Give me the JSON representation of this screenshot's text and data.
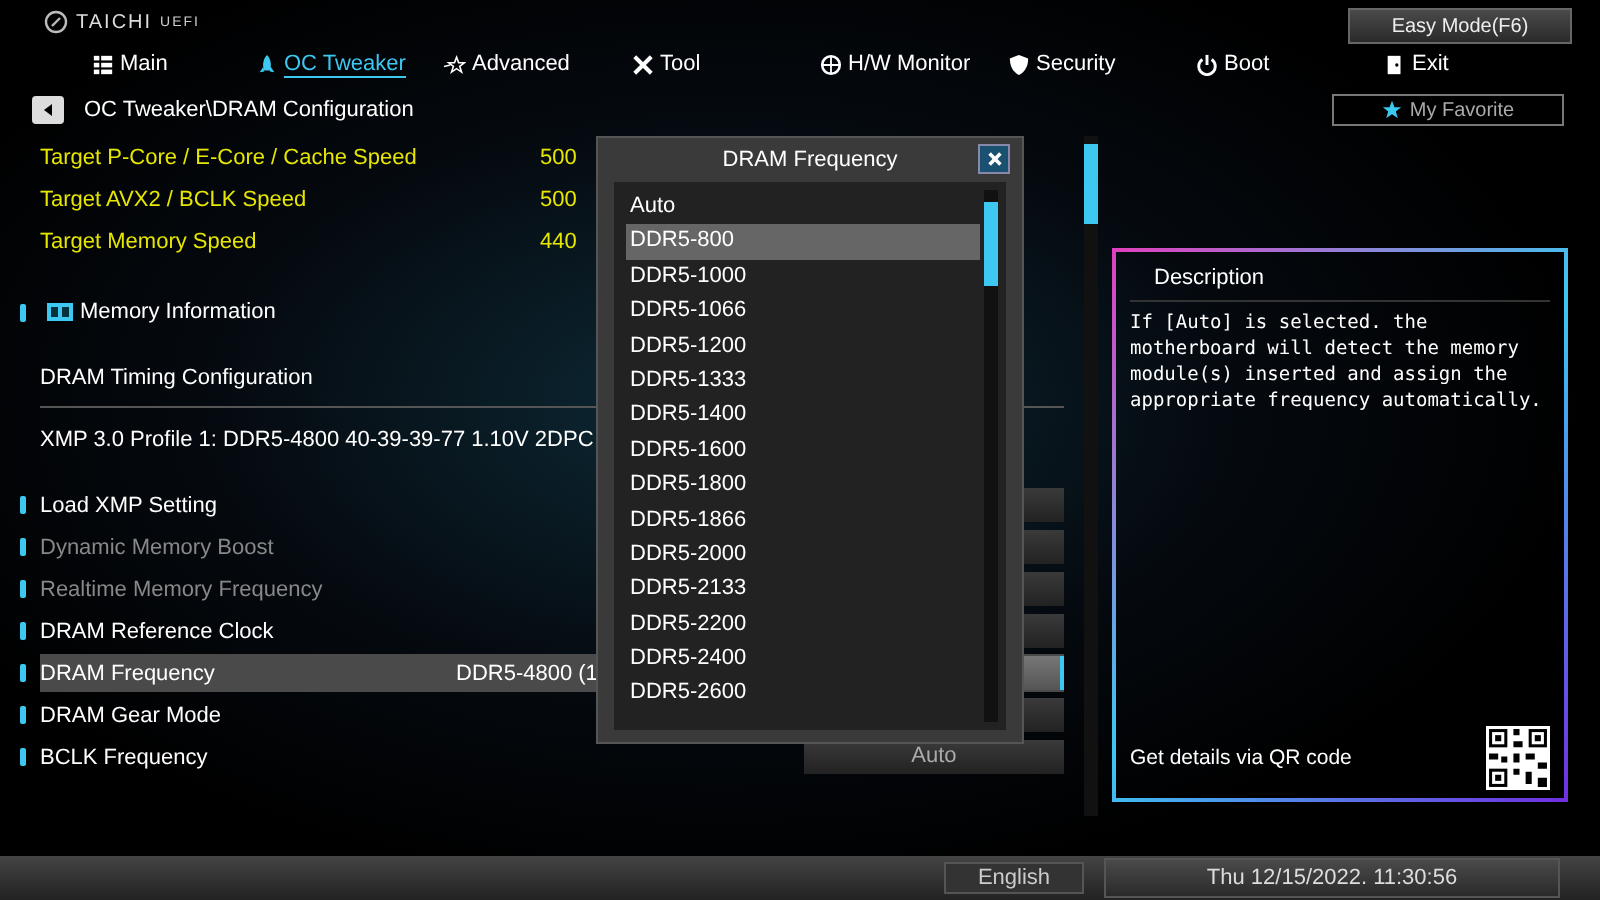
{
  "header": {
    "logo": "TAICHI",
    "logo_sub": "UEFI",
    "easy_mode": "Easy Mode(F6)",
    "my_favorite": "My Favorite"
  },
  "tabs": [
    {
      "label": "Main",
      "kind": "main",
      "selected": false
    },
    {
      "label": "OC Tweaker",
      "kind": "oc",
      "selected": true
    },
    {
      "label": "Advanced",
      "kind": "advanced",
      "selected": false
    },
    {
      "label": "Tool",
      "kind": "tool",
      "selected": false
    },
    {
      "label": "H/W Monitor",
      "kind": "monitor",
      "selected": false
    },
    {
      "label": "Security",
      "kind": "security",
      "selected": false
    },
    {
      "label": "Boot",
      "kind": "boot",
      "selected": false
    },
    {
      "label": "Exit",
      "kind": "exit",
      "selected": false
    }
  ],
  "breadcrumb": "OC Tweaker\\DRAM Configuration",
  "targets": [
    {
      "label": "Target P-Core / E-Core / Cache Speed",
      "value": "500"
    },
    {
      "label": "Target AVX2 / BCLK Speed",
      "value": "500"
    },
    {
      "label": "Target Memory Speed",
      "value": "440"
    }
  ],
  "memory_info": "Memory Information",
  "timing_config": "DRAM Timing Configuration",
  "xmp": "XMP 3.0 Profile 1: DDR5-4800 40-39-39-77 1.10V 2DPC",
  "settings": [
    {
      "label": "Load XMP Setting",
      "disabled": false,
      "selected": false
    },
    {
      "label": "Dynamic Memory Boost",
      "disabled": true,
      "selected": false
    },
    {
      "label": "Realtime Memory Frequency",
      "disabled": true,
      "selected": false
    },
    {
      "label": "DRAM Reference Clock",
      "disabled": false,
      "selected": false
    },
    {
      "label": "DRAM Frequency",
      "value": "DDR5-4800 (1",
      "disabled": false,
      "selected": true
    },
    {
      "label": "DRAM Gear Mode",
      "disabled": false,
      "selected": false
    },
    {
      "label": "BCLK Frequency",
      "box_value": "Auto",
      "disabled": false,
      "selected": false
    }
  ],
  "popup": {
    "title": "DRAM Frequency",
    "options": [
      {
        "label": "Auto",
        "selected": false
      },
      {
        "label": "DDR5-800",
        "selected": true
      },
      {
        "label": "DDR5-1000",
        "selected": false
      },
      {
        "label": "DDR5-1066",
        "selected": false
      },
      {
        "label": "DDR5-1200",
        "selected": false
      },
      {
        "label": "DDR5-1333",
        "selected": false
      },
      {
        "label": "DDR5-1400",
        "selected": false
      },
      {
        "label": "DDR5-1600",
        "selected": false
      },
      {
        "label": "DDR5-1800",
        "selected": false
      },
      {
        "label": "DDR5-1866",
        "selected": false
      },
      {
        "label": "DDR5-2000",
        "selected": false
      },
      {
        "label": "DDR5-2133",
        "selected": false
      },
      {
        "label": "DDR5-2200",
        "selected": false
      },
      {
        "label": "DDR5-2400",
        "selected": false
      },
      {
        "label": "DDR5-2600",
        "selected": false
      }
    ]
  },
  "description": {
    "title": "Description",
    "text": "If [Auto] is selected. the motherboard will detect the memory module(s) inserted and assign the appropriate frequency automatically.",
    "qr_caption": "Get details via QR code"
  },
  "status": {
    "language": "English",
    "datetime": "Thu 12/15/2022. 11:30:56"
  }
}
